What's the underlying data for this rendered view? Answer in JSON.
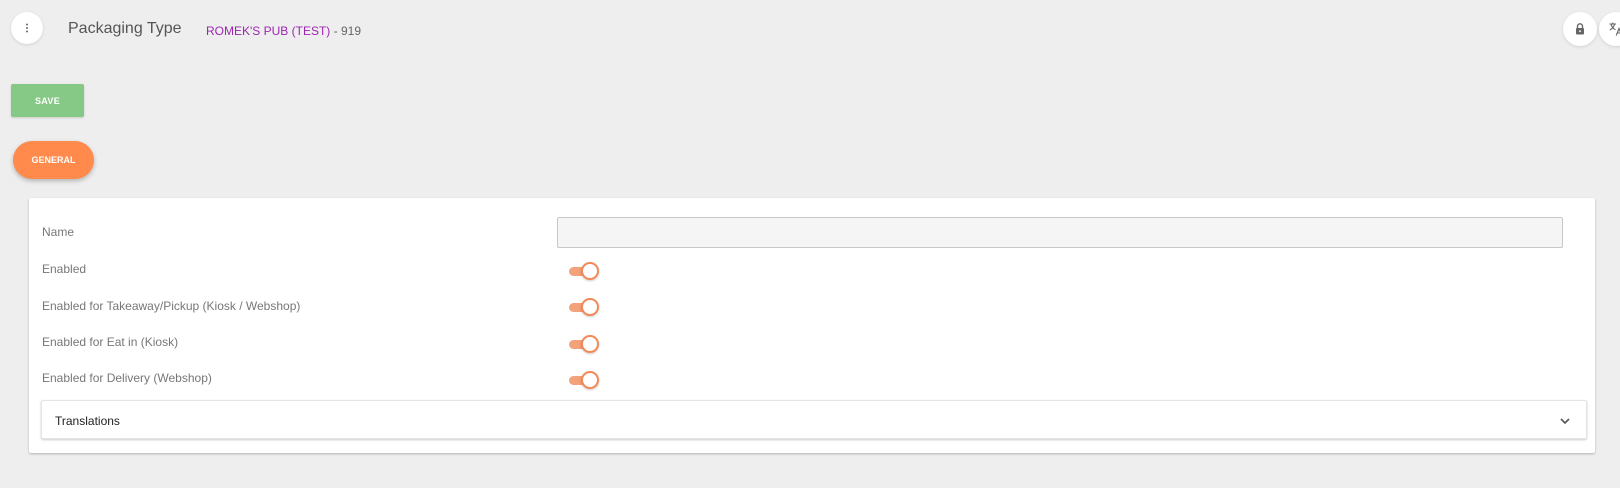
{
  "header": {
    "title": "Packaging Type",
    "org_name": "ROMEK'S PUB (TEST)",
    "org_suffix": " - 919",
    "menu_icon": "more-vertical-icon",
    "lock_icon": "lock-icon",
    "translate_icon": "translate-icon"
  },
  "toolbar": {
    "save_label": "SAVE"
  },
  "tabs": [
    {
      "label": "GENERAL",
      "active": true
    }
  ],
  "form": {
    "name": {
      "label": "Name",
      "value": "",
      "placeholder": ""
    },
    "toggles": [
      {
        "label": "Enabled",
        "on": true
      },
      {
        "label": "Enabled for Takeaway/Pickup (Kiosk / Webshop)",
        "on": true
      },
      {
        "label": "Enabled for Eat in (Kiosk)",
        "on": true
      },
      {
        "label": "Enabled for Delivery (Webshop)",
        "on": true
      }
    ],
    "translations": {
      "label": "Translations",
      "icon": "chevron-down-icon"
    }
  },
  "colors": {
    "background": "#eeeeee",
    "save_button": "#86c986",
    "tab_active": "#ff8a4c",
    "org_name": "#9c27b0",
    "toggle_track": "#f4a27a",
    "toggle_knob_border": "#f28a58"
  }
}
